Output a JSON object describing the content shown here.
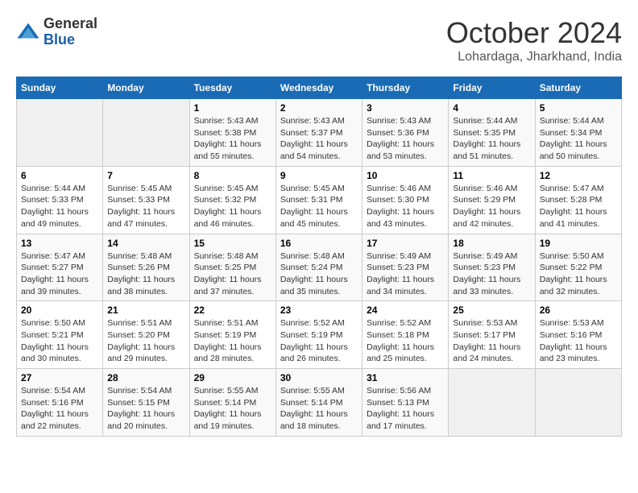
{
  "logo": {
    "general": "General",
    "blue": "Blue"
  },
  "title": {
    "month": "October 2024",
    "location": "Lohardaga, Jharkhand, India"
  },
  "headers": [
    "Sunday",
    "Monday",
    "Tuesday",
    "Wednesday",
    "Thursday",
    "Friday",
    "Saturday"
  ],
  "weeks": [
    [
      {
        "day": "",
        "empty": true
      },
      {
        "day": "",
        "empty": true
      },
      {
        "day": "1",
        "sunrise": "Sunrise: 5:43 AM",
        "sunset": "Sunset: 5:38 PM",
        "daylight": "Daylight: 11 hours and 55 minutes."
      },
      {
        "day": "2",
        "sunrise": "Sunrise: 5:43 AM",
        "sunset": "Sunset: 5:37 PM",
        "daylight": "Daylight: 11 hours and 54 minutes."
      },
      {
        "day": "3",
        "sunrise": "Sunrise: 5:43 AM",
        "sunset": "Sunset: 5:36 PM",
        "daylight": "Daylight: 11 hours and 53 minutes."
      },
      {
        "day": "4",
        "sunrise": "Sunrise: 5:44 AM",
        "sunset": "Sunset: 5:35 PM",
        "daylight": "Daylight: 11 hours and 51 minutes."
      },
      {
        "day": "5",
        "sunrise": "Sunrise: 5:44 AM",
        "sunset": "Sunset: 5:34 PM",
        "daylight": "Daylight: 11 hours and 50 minutes."
      }
    ],
    [
      {
        "day": "6",
        "sunrise": "Sunrise: 5:44 AM",
        "sunset": "Sunset: 5:33 PM",
        "daylight": "Daylight: 11 hours and 49 minutes."
      },
      {
        "day": "7",
        "sunrise": "Sunrise: 5:45 AM",
        "sunset": "Sunset: 5:33 PM",
        "daylight": "Daylight: 11 hours and 47 minutes."
      },
      {
        "day": "8",
        "sunrise": "Sunrise: 5:45 AM",
        "sunset": "Sunset: 5:32 PM",
        "daylight": "Daylight: 11 hours and 46 minutes."
      },
      {
        "day": "9",
        "sunrise": "Sunrise: 5:45 AM",
        "sunset": "Sunset: 5:31 PM",
        "daylight": "Daylight: 11 hours and 45 minutes."
      },
      {
        "day": "10",
        "sunrise": "Sunrise: 5:46 AM",
        "sunset": "Sunset: 5:30 PM",
        "daylight": "Daylight: 11 hours and 43 minutes."
      },
      {
        "day": "11",
        "sunrise": "Sunrise: 5:46 AM",
        "sunset": "Sunset: 5:29 PM",
        "daylight": "Daylight: 11 hours and 42 minutes."
      },
      {
        "day": "12",
        "sunrise": "Sunrise: 5:47 AM",
        "sunset": "Sunset: 5:28 PM",
        "daylight": "Daylight: 11 hours and 41 minutes."
      }
    ],
    [
      {
        "day": "13",
        "sunrise": "Sunrise: 5:47 AM",
        "sunset": "Sunset: 5:27 PM",
        "daylight": "Daylight: 11 hours and 39 minutes."
      },
      {
        "day": "14",
        "sunrise": "Sunrise: 5:48 AM",
        "sunset": "Sunset: 5:26 PM",
        "daylight": "Daylight: 11 hours and 38 minutes."
      },
      {
        "day": "15",
        "sunrise": "Sunrise: 5:48 AM",
        "sunset": "Sunset: 5:25 PM",
        "daylight": "Daylight: 11 hours and 37 minutes."
      },
      {
        "day": "16",
        "sunrise": "Sunrise: 5:48 AM",
        "sunset": "Sunset: 5:24 PM",
        "daylight": "Daylight: 11 hours and 35 minutes."
      },
      {
        "day": "17",
        "sunrise": "Sunrise: 5:49 AM",
        "sunset": "Sunset: 5:23 PM",
        "daylight": "Daylight: 11 hours and 34 minutes."
      },
      {
        "day": "18",
        "sunrise": "Sunrise: 5:49 AM",
        "sunset": "Sunset: 5:23 PM",
        "daylight": "Daylight: 11 hours and 33 minutes."
      },
      {
        "day": "19",
        "sunrise": "Sunrise: 5:50 AM",
        "sunset": "Sunset: 5:22 PM",
        "daylight": "Daylight: 11 hours and 32 minutes."
      }
    ],
    [
      {
        "day": "20",
        "sunrise": "Sunrise: 5:50 AM",
        "sunset": "Sunset: 5:21 PM",
        "daylight": "Daylight: 11 hours and 30 minutes."
      },
      {
        "day": "21",
        "sunrise": "Sunrise: 5:51 AM",
        "sunset": "Sunset: 5:20 PM",
        "daylight": "Daylight: 11 hours and 29 minutes."
      },
      {
        "day": "22",
        "sunrise": "Sunrise: 5:51 AM",
        "sunset": "Sunset: 5:19 PM",
        "daylight": "Daylight: 11 hours and 28 minutes."
      },
      {
        "day": "23",
        "sunrise": "Sunrise: 5:52 AM",
        "sunset": "Sunset: 5:19 PM",
        "daylight": "Daylight: 11 hours and 26 minutes."
      },
      {
        "day": "24",
        "sunrise": "Sunrise: 5:52 AM",
        "sunset": "Sunset: 5:18 PM",
        "daylight": "Daylight: 11 hours and 25 minutes."
      },
      {
        "day": "25",
        "sunrise": "Sunrise: 5:53 AM",
        "sunset": "Sunset: 5:17 PM",
        "daylight": "Daylight: 11 hours and 24 minutes."
      },
      {
        "day": "26",
        "sunrise": "Sunrise: 5:53 AM",
        "sunset": "Sunset: 5:16 PM",
        "daylight": "Daylight: 11 hours and 23 minutes."
      }
    ],
    [
      {
        "day": "27",
        "sunrise": "Sunrise: 5:54 AM",
        "sunset": "Sunset: 5:16 PM",
        "daylight": "Daylight: 11 hours and 22 minutes."
      },
      {
        "day": "28",
        "sunrise": "Sunrise: 5:54 AM",
        "sunset": "Sunset: 5:15 PM",
        "daylight": "Daylight: 11 hours and 20 minutes."
      },
      {
        "day": "29",
        "sunrise": "Sunrise: 5:55 AM",
        "sunset": "Sunset: 5:14 PM",
        "daylight": "Daylight: 11 hours and 19 minutes."
      },
      {
        "day": "30",
        "sunrise": "Sunrise: 5:55 AM",
        "sunset": "Sunset: 5:14 PM",
        "daylight": "Daylight: 11 hours and 18 minutes."
      },
      {
        "day": "31",
        "sunrise": "Sunrise: 5:56 AM",
        "sunset": "Sunset: 5:13 PM",
        "daylight": "Daylight: 11 hours and 17 minutes."
      },
      {
        "day": "",
        "empty": true
      },
      {
        "day": "",
        "empty": true
      }
    ]
  ]
}
